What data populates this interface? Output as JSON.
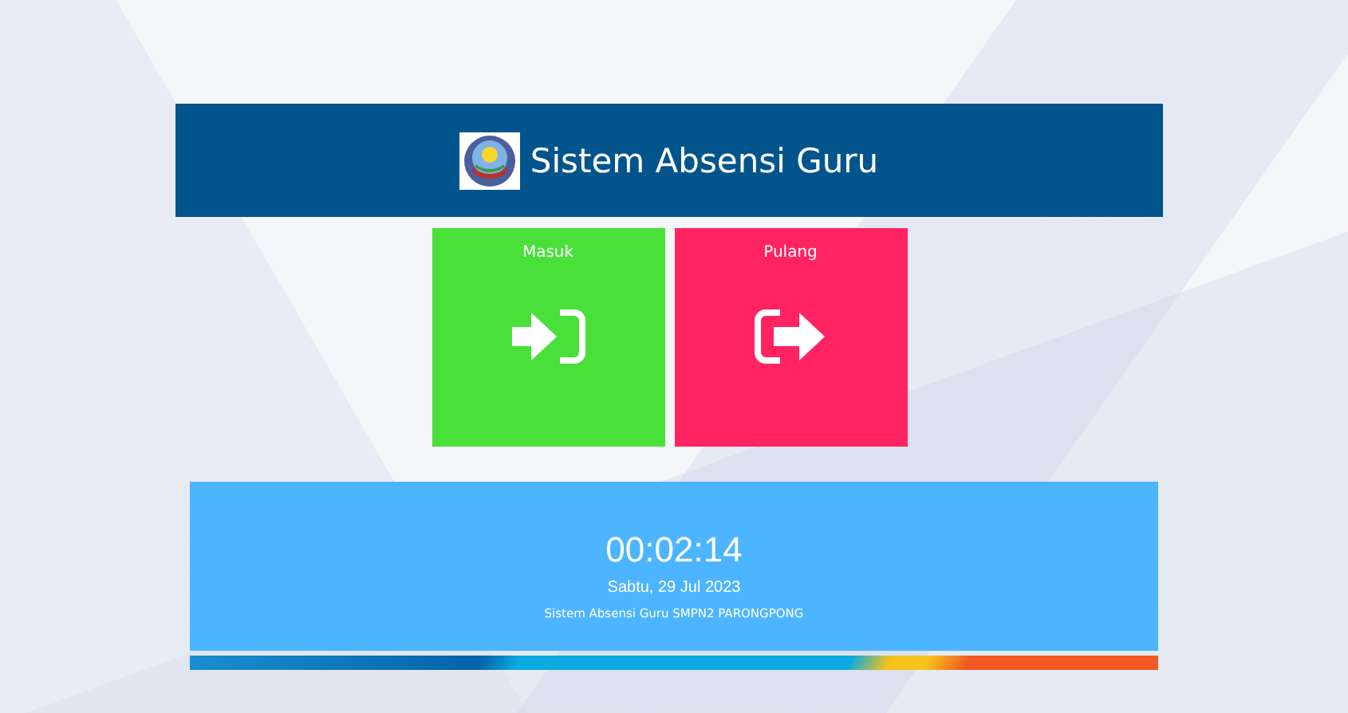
{
  "header": {
    "title": "Sistem Absensi Guru"
  },
  "actions": [
    {
      "kind": "in",
      "label": "Masuk"
    },
    {
      "kind": "out",
      "label": "Pulang"
    }
  ],
  "clock": {
    "time": "00:02:14",
    "date": "Sabtu, 29 Jul 2023",
    "caption": "Sistem Absensi Guru SMPN2 PARONGPONG"
  }
}
